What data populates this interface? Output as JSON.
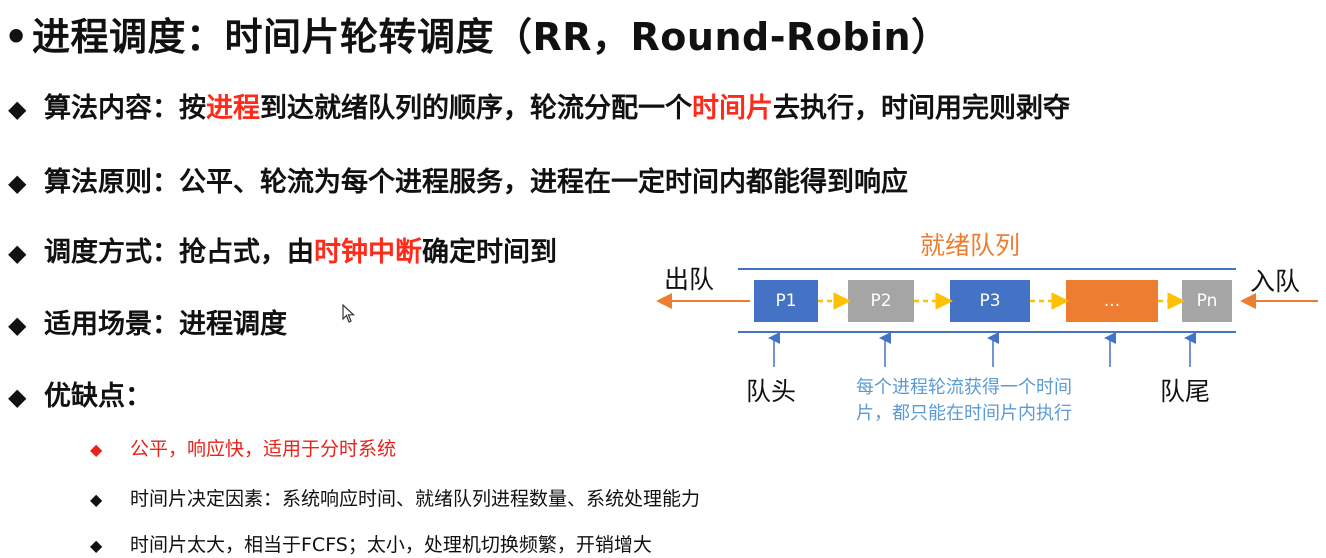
{
  "title": "进程调度：时间片轮转调度（RR，Round-Robin）",
  "title_bullet": "•",
  "lines": [
    {
      "label": "算法内容：",
      "parts": [
        {
          "t": "按",
          "red": false
        },
        {
          "t": "进程",
          "red": true
        },
        {
          "t": "到达就绪队列的顺序，轮流分配一个",
          "red": false
        },
        {
          "t": "时间片",
          "red": true
        },
        {
          "t": "去执行，时间用完则剥夺",
          "red": false
        }
      ]
    },
    {
      "label": "算法原则：",
      "parts": [
        {
          "t": "公平、轮流为每个进程服务，进程在一定时间内都能得到响应",
          "red": false
        }
      ]
    },
    {
      "label": "调度方式：",
      "parts": [
        {
          "t": "抢占式，由",
          "red": false
        },
        {
          "t": "时钟中断",
          "red": true
        },
        {
          "t": "确定时间到",
          "red": false
        }
      ]
    },
    {
      "label": "适用场景：",
      "parts": [
        {
          "t": "进程调度",
          "red": false
        }
      ]
    },
    {
      "label": "优缺点：",
      "parts": []
    }
  ],
  "sub_items": [
    {
      "text": "公平，响应快，适用于分时系统",
      "red": true
    },
    {
      "text": "时间片决定因素：系统响应时间、就绪队列进程数量、系统处理能力",
      "red": false
    },
    {
      "text": "时间片太大，相当于FCFS；太小，处理机切换频繁，开销增大",
      "red": false
    }
  ],
  "diagram": {
    "queue_title": "就绪队列",
    "dequeue_label": "出队",
    "enqueue_label": "入队",
    "boxes": [
      "P1",
      "P2",
      "P3",
      "...",
      "Pn"
    ],
    "head_label": "队头",
    "tail_label": "队尾",
    "note_lines": [
      "每个进程轮流获得一个时间",
      "片，都只能在时间片内执行"
    ]
  },
  "colors": {
    "red": "#ff2a1a",
    "orange": "#ed7d31",
    "blue_box": "#4472c4",
    "gray_box": "#a5a5a5",
    "queue_line": "#4472c4",
    "dashed_arrow": "#ffc000",
    "note_blue": "#5b9bd5"
  },
  "icons": [
    "diamond-bullet-icon",
    "mouse-cursor-icon",
    "arrow-left-icon",
    "arrow-up-icon"
  ]
}
